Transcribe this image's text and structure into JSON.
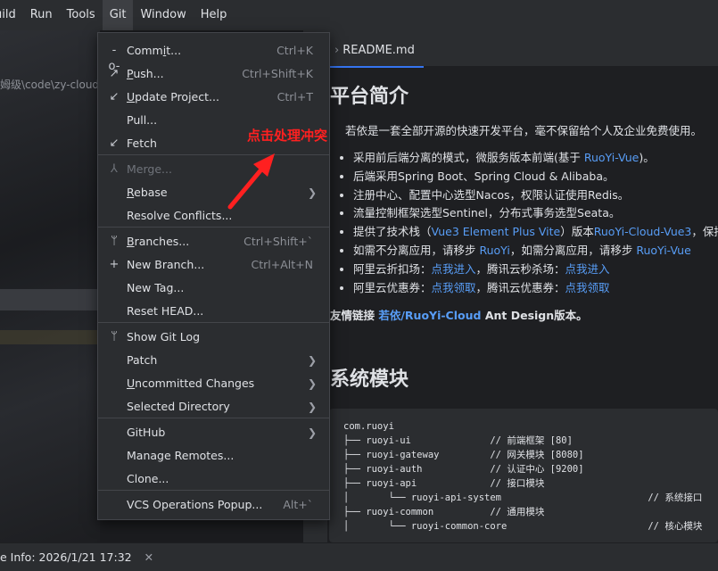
{
  "menubar": [
    "uild",
    "Run",
    "Tools",
    "Git",
    "Window",
    "Help"
  ],
  "left": {
    "path": "姆级\\code\\zy-cloud"
  },
  "editor": {
    "tab": "README.md",
    "h1": "平台简介",
    "desc": "若依是一套全部开源的快速开发平台，毫不保留给个人及企业免费使用。",
    "bullets": [
      {
        "pre": "采用前后端分离的模式，微服务版本前端(基于 ",
        "link": "RuoYi-Vue",
        "post": ")。"
      },
      {
        "pre": "后端采用Spring Boot、Spring Cloud & Alibaba。",
        "link": "",
        "post": ""
      },
      {
        "pre": "注册中心、配置中心选型Nacos，权限认证使用Redis。",
        "link": "",
        "post": ""
      },
      {
        "pre": "流量控制框架选型Sentinel，分布式事务选型Seata。",
        "link": "",
        "post": ""
      },
      {
        "pre": "提供了技术栈（",
        "link": "Vue3 Element Plus Vite",
        "post": "）版本",
        "link2": "RuoYi-Cloud-Vue3",
        "post2": "，保持"
      },
      {
        "pre": "如需不分离应用，请移步 ",
        "link": "RuoYi",
        "post": "，如需分离应用，请移步 ",
        "link2": "RuoYi-Vue",
        "post2": ""
      },
      {
        "pre": "阿里云折扣场：",
        "link": "点我进入",
        "post": "，腾讯云秒杀场：",
        "link2": "点我进入",
        "post2": ""
      },
      {
        "pre": "阿里云优惠券：",
        "link": "点我领取",
        "post": "，腾讯云优惠券：",
        "link2": "点我领取",
        "post2": ""
      }
    ],
    "friend_pre": "友情链接 ",
    "friend_link": "若依/RuoYi-Cloud",
    "friend_post": " Ant Design版本。",
    "h2": "系统模块",
    "code": [
      "com.ruoyi",
      "├── ruoyi-ui              // 前端框架 [80]",
      "├── ruoyi-gateway         // 网关模块 [8080]",
      "├── ruoyi-auth            // 认证中心 [9200]",
      "├── ruoyi-api             // 接口模块",
      "│       └── ruoyi-api-system                          // 系统接口",
      "├── ruoyi-common          // 通用模块",
      "│       └── ruoyi-common-core                         // 核心模块"
    ]
  },
  "statusbar": {
    "text": "e Info: 2026/1/21 17:32",
    "close": "✕"
  },
  "gitmenu": {
    "items": [
      {
        "icon": "-o-",
        "label": "Commit...",
        "u": "i",
        "shortcut": "Ctrl+K"
      },
      {
        "icon": "↗",
        "label": "Push...",
        "u": "P",
        "shortcut": "Ctrl+Shift+K"
      },
      {
        "icon": "↙",
        "label": "Update Project...",
        "u": "U",
        "shortcut": "Ctrl+T"
      },
      {
        "icon": "",
        "label": "Pull...",
        "u": "",
        "shortcut": ""
      },
      {
        "icon": "↙",
        "label": "Fetch",
        "u": "",
        "shortcut": ""
      },
      {
        "icon": "⅄",
        "label": "Merge...",
        "u": "",
        "shortcut": "",
        "disabled": true
      },
      {
        "icon": "",
        "label": "Rebase",
        "u": "R",
        "shortcut": "",
        "submenu": true
      },
      {
        "icon": "",
        "label": "Resolve Conflicts...",
        "u": "",
        "shortcut": ""
      },
      {
        "icon": "ᛘ",
        "label": "Branches...",
        "u": "B",
        "shortcut": "Ctrl+Shift+`"
      },
      {
        "icon": "+",
        "label": "New Branch...",
        "u": "",
        "shortcut": "Ctrl+Alt+N"
      },
      {
        "icon": "",
        "label": "New Tag...",
        "u": "",
        "shortcut": ""
      },
      {
        "icon": "",
        "label": "Reset HEAD...",
        "u": "",
        "shortcut": ""
      },
      {
        "icon": "ᛘ",
        "label": "Show Git Log",
        "u": "",
        "shortcut": ""
      },
      {
        "icon": "",
        "label": "Patch",
        "u": "",
        "shortcut": "",
        "submenu": true
      },
      {
        "icon": "",
        "label": "Uncommitted Changes",
        "u": "U",
        "shortcut": "",
        "submenu": true
      },
      {
        "icon": "",
        "label": "Selected Directory",
        "u": "",
        "shortcut": "",
        "submenu": true
      },
      {
        "icon": "",
        "label": "GitHub",
        "u": "",
        "shortcut": "",
        "submenu": true
      },
      {
        "icon": "",
        "label": "Manage Remotes...",
        "u": "",
        "shortcut": ""
      },
      {
        "icon": "",
        "label": "Clone...",
        "u": "",
        "shortcut": ""
      },
      {
        "icon": "",
        "label": "VCS Operations Popup...",
        "u": "",
        "shortcut": "Alt+`"
      }
    ]
  },
  "annotation": {
    "text": "点击处理冲突",
    "color": "#ff2020"
  },
  "colors": {
    "accent": "#3574f0",
    "link": "#589df6",
    "menu_bg": "#2b2d30",
    "editor_bg": "#1e1f22"
  }
}
